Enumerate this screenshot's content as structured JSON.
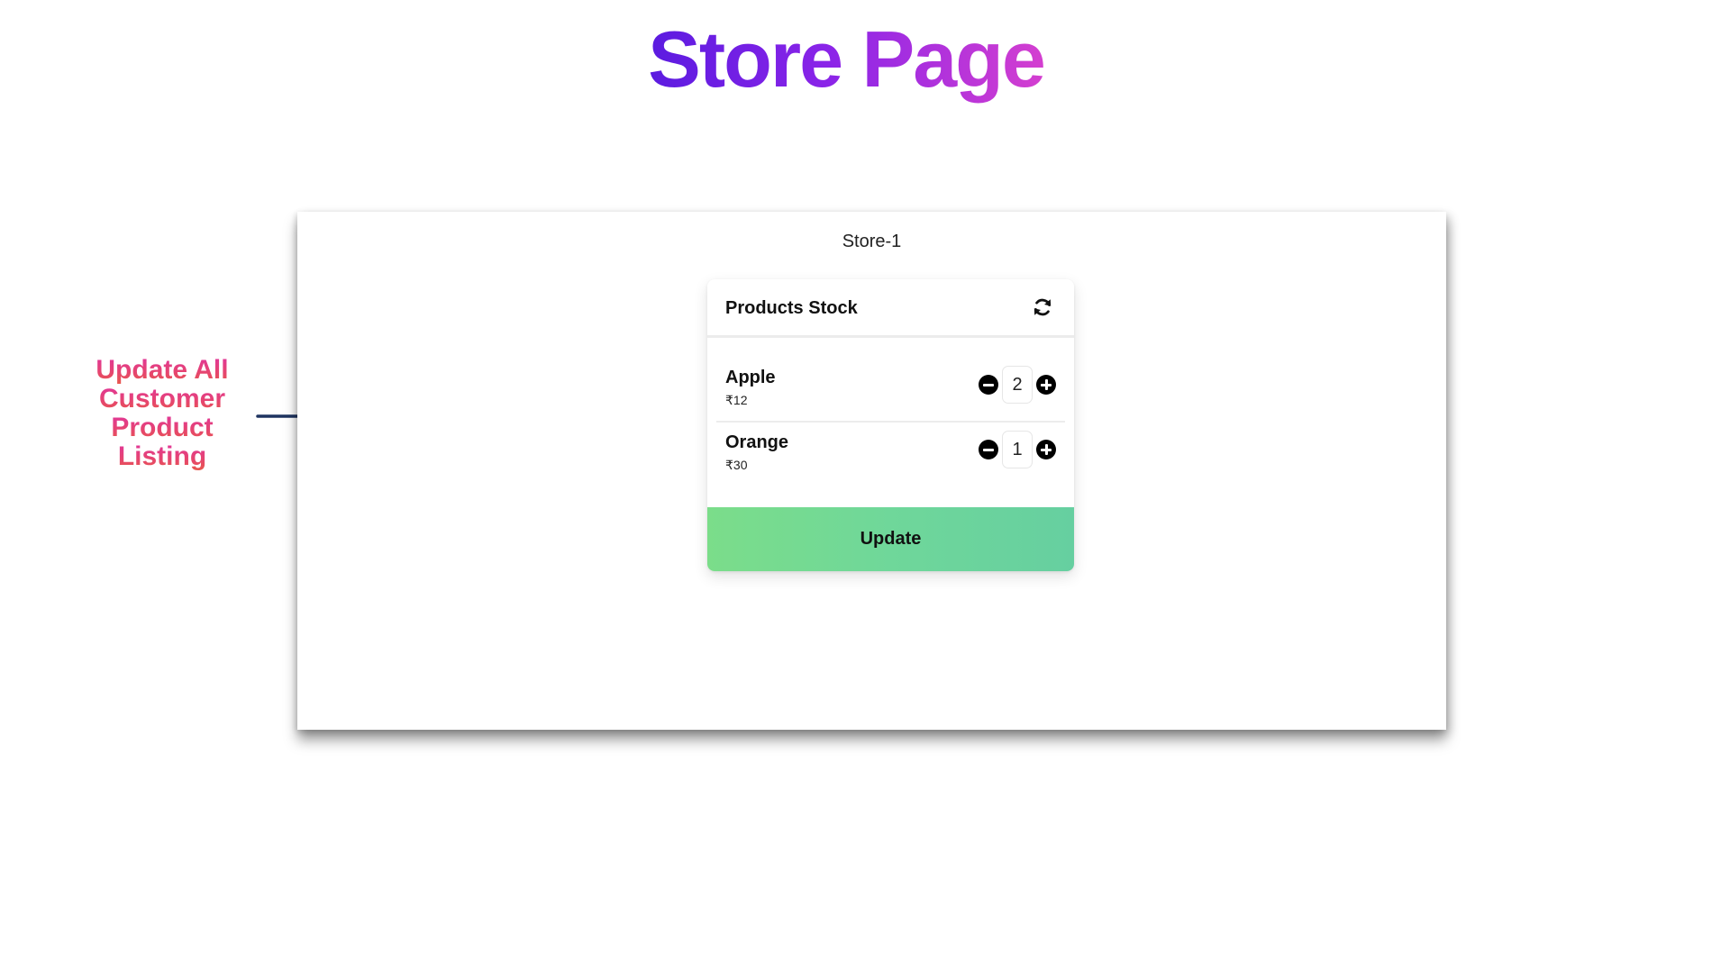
{
  "slide": {
    "title": "Store Page",
    "annotation": "Update All Customer Product Listing"
  },
  "store": {
    "name": "Store-1"
  },
  "card": {
    "title": "Products Stock",
    "refresh_icon": "refresh-icon",
    "items": [
      {
        "name": "Apple",
        "price": "₹12",
        "quantity": "2"
      },
      {
        "name": "Orange",
        "price": "₹30",
        "quantity": "1"
      }
    ],
    "update_label": "Update"
  },
  "colors": {
    "title_gradient": [
      "#5b1be0",
      "#d43fd0"
    ],
    "annotation_gradient": [
      "#e0349f",
      "#e8594a"
    ],
    "arrow": "#1f3460",
    "update_gradient": [
      "#7bdd8a",
      "#66cfa0"
    ]
  }
}
